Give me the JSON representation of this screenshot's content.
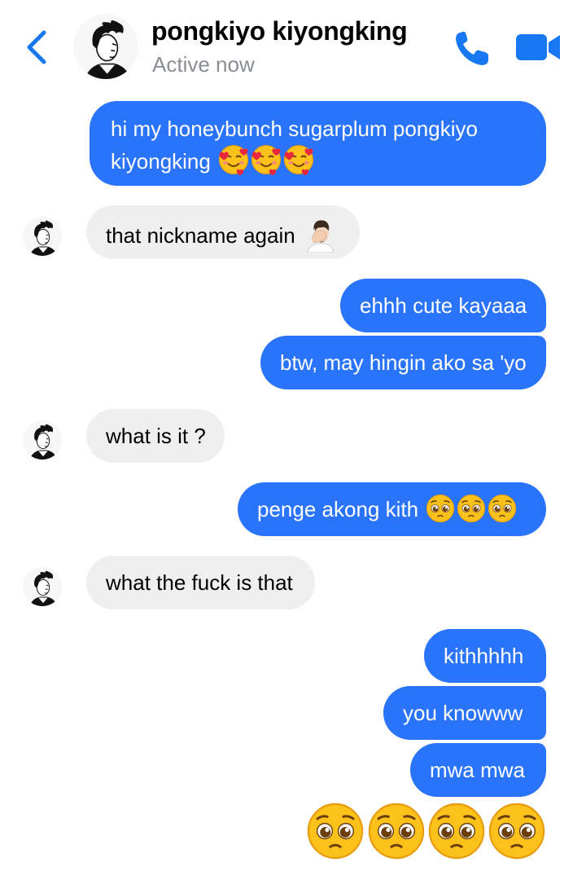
{
  "header": {
    "name": "pongkiyo kiyongking",
    "status": "Active now"
  },
  "icons": {
    "back": "chevron-left-icon",
    "call": "phone-icon",
    "video": "video-camera-icon",
    "smiling_face_with_hearts": "🥰",
    "face_palm": "🤦🏻‍♂️",
    "pleading_face": "🥺"
  },
  "colors": {
    "accent": "#1877f2",
    "outgoing_bubble": "#2a74fb",
    "incoming_bubble": "#efefef",
    "status_text": "#8a8d91"
  },
  "messages": [
    {
      "from": "me",
      "line1": "hi my honeybunch sugarplum pongkiyo",
      "line2": "kiyongking",
      "emoji": "🥰🥰🥰"
    },
    {
      "from": "them",
      "text": "that nickname again",
      "emoji": "🤦🏻‍♂️"
    },
    {
      "from": "me",
      "text": "ehhh cute kayaaa"
    },
    {
      "from": "me",
      "text": "btw, may hingin ako sa 'yo"
    },
    {
      "from": "them",
      "text": "what is it ?"
    },
    {
      "from": "me",
      "text": "penge akong kith",
      "emoji": "🥺🥺🥺"
    },
    {
      "from": "them",
      "text": "what the fuck is that"
    },
    {
      "from": "me",
      "text": "kithhhhh"
    },
    {
      "from": "me",
      "text": "you knowww"
    },
    {
      "from": "me",
      "text": "mwa mwa"
    },
    {
      "from": "me",
      "emoji": "🥺🥺🥺🥺"
    }
  ]
}
